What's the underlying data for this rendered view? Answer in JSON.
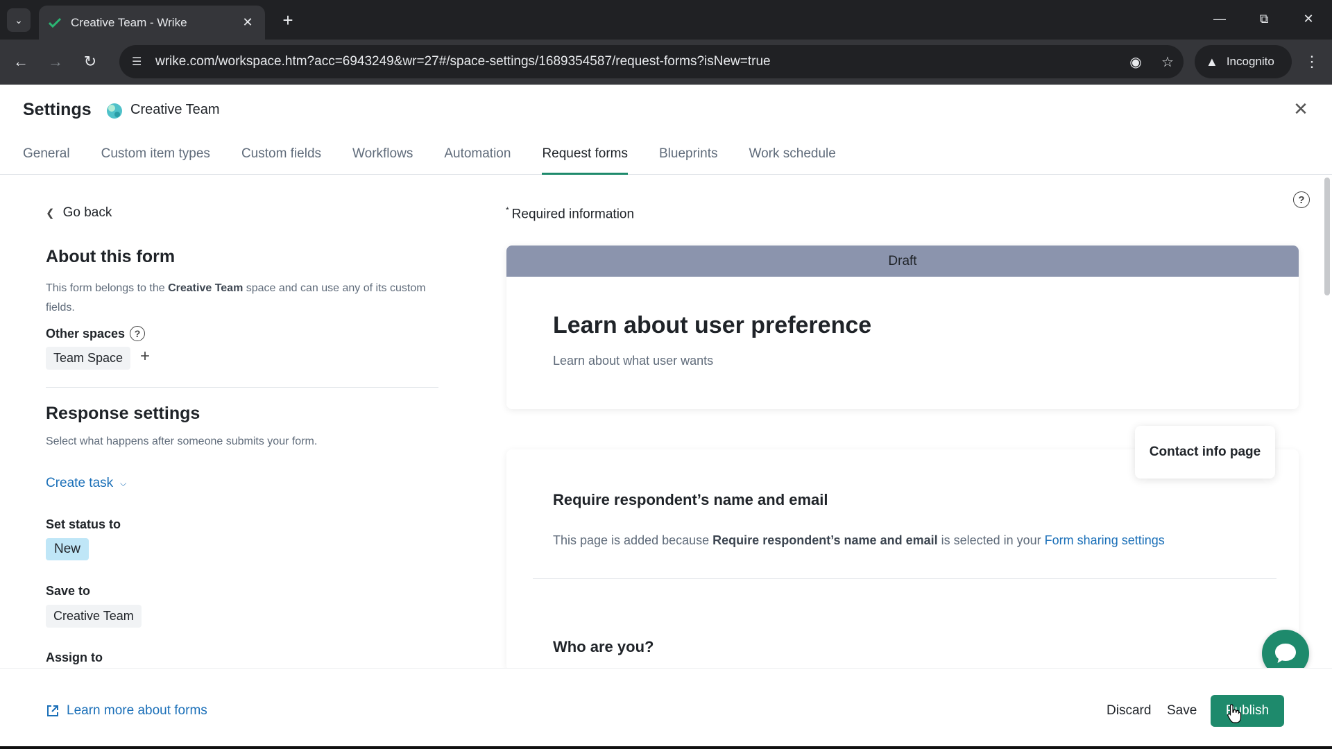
{
  "browser": {
    "tab_title": "Creative Team - Wrike",
    "url": "wrike.com/workspace.htm?acc=6943249&wr=27#/space-settings/1689354587/request-forms?isNew=true",
    "profile_label": "Incognito"
  },
  "header": {
    "title": "Settings",
    "space_name": "Creative Team",
    "tabs": [
      {
        "label": "General"
      },
      {
        "label": "Custom item types"
      },
      {
        "label": "Custom fields"
      },
      {
        "label": "Workflows"
      },
      {
        "label": "Automation"
      },
      {
        "label": "Request forms",
        "active": true
      },
      {
        "label": "Blueprints"
      },
      {
        "label": "Work schedule"
      }
    ]
  },
  "left": {
    "go_back": "Go back",
    "about_title": "About this form",
    "about_desc_1": "This form belongs to the ",
    "about_desc_space": "Creative Team",
    "about_desc_2": " space and can use any of its custom fields.",
    "other_spaces_label": "Other spaces",
    "other_spaces_chip": "Team Space",
    "response_title": "Response settings",
    "response_desc": "Select what happens after someone submits your form.",
    "create_task": "Create task",
    "set_status_label": "Set status to",
    "status_value": "New",
    "save_to_label": "Save to",
    "save_to_value": "Creative Team",
    "assign_to_label": "Assign to"
  },
  "right": {
    "required_mark": "*",
    "required_info": "Required information",
    "draft_label": "Draft",
    "form_title": "Learn about user preference",
    "form_subtitle": "Learn about what user wants",
    "contact_page_label": "Contact info page",
    "require_title": "Require respondent’s name and email",
    "page_added_1": "This page is added because ",
    "page_added_bold": "Require respondent’s name and email",
    "page_added_2": " is selected in your ",
    "page_added_link": "Form sharing settings",
    "who_title": "Who are you?"
  },
  "footer": {
    "learn_more": "Learn more about forms",
    "discard": "Discard",
    "save": "Save",
    "publish": "Publish"
  },
  "colors": {
    "accent_green": "#1e8a6c",
    "link_blue": "#1a6fb8",
    "draft_band": "#8b94ad",
    "status_chip": "#bfe6f7"
  }
}
